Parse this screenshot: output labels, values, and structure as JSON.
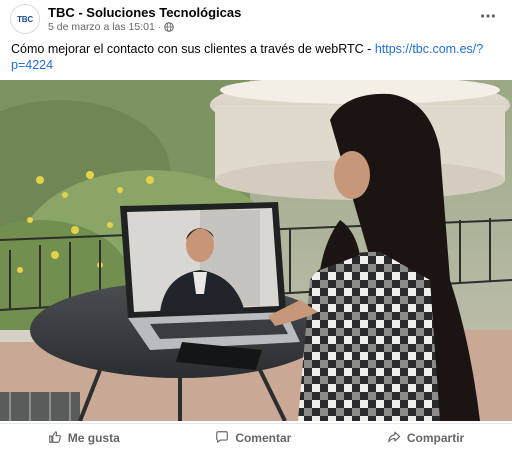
{
  "post": {
    "page_name": "TBC - Soluciones Tecnológicas",
    "avatar_text": "TBC",
    "timestamp": "5 de marzo a las 15:01",
    "separator": "·",
    "text_before_link": "Cómo mejorar el contacto con sus clientes a través de webRTC - ",
    "link_text": "https://tbc.com.es/?p=4224",
    "link_href": "https://tbc.com.es/?p=4224"
  },
  "icons": {
    "more": "more-options-icon",
    "globe": "globe-icon",
    "like": "thumbs-up-icon",
    "comment": "comment-bubble-icon",
    "share": "share-arrow-icon"
  },
  "actions": {
    "like_label": "Me gusta",
    "comment_label": "Comentar",
    "share_label": "Compartir"
  },
  "colors": {
    "link": "#216fdb",
    "secondary_text": "#65676b"
  }
}
